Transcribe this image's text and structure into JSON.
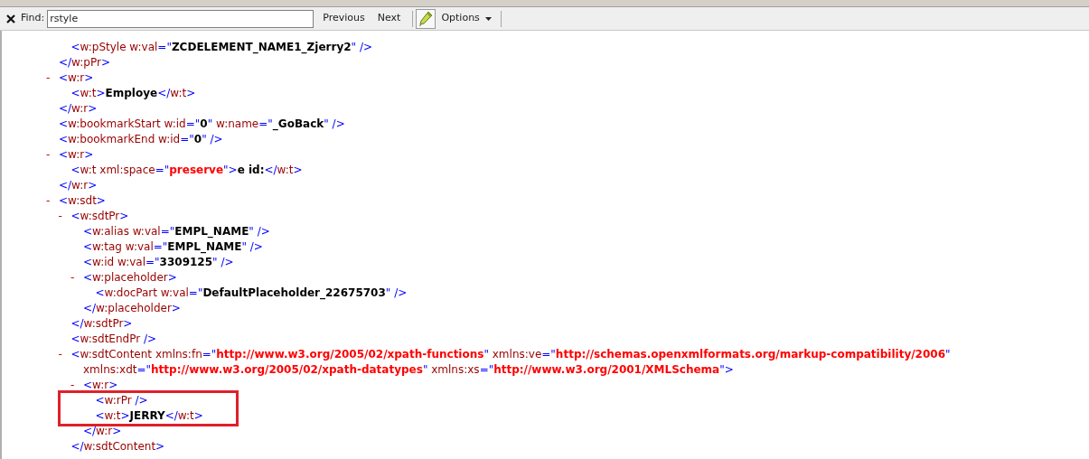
{
  "find_bar": {
    "label": "Find:",
    "value": "rstyle",
    "buttons": [
      "Previous",
      "Next"
    ],
    "marker_tool": {
      "pressed": true
    },
    "options": "Options"
  },
  "xml_tree": [
    {
      "children": [
        {
          "lines": [
            [
              {
                "kind": "punct",
                "text": "<"
              },
              {
                "kind": "name",
                "text": "w:pStyle w:val"
              },
              {
                "kind": "punct",
                "text": "=\""
              },
              {
                "kind": "value",
                "text": "ZCDELEMENT_NAME1_Zjerry2"
              },
              {
                "kind": "punct",
                "text": "\" />"
              }
            ]
          ]
        }
      ],
      "close": [
        {
          "kind": "punct",
          "text": "</"
        },
        {
          "kind": "name",
          "text": "w:pPr"
        },
        {
          "kind": "punct",
          "text": ">"
        }
      ]
    },
    {
      "toggle": "-",
      "lines": [
        [
          {
            "kind": "punct",
            "text": "<"
          },
          {
            "kind": "name",
            "text": "w:r"
          },
          {
            "kind": "punct",
            "text": ">"
          }
        ]
      ],
      "children": [
        {
          "lines": [
            [
              {
                "kind": "punct",
                "text": "<"
              },
              {
                "kind": "name",
                "text": "w:t"
              },
              {
                "kind": "punct",
                "text": ">"
              },
              {
                "kind": "value",
                "text": "Employe"
              },
              {
                "kind": "punct",
                "text": "</"
              },
              {
                "kind": "name",
                "text": "w:t"
              },
              {
                "kind": "punct",
                "text": ">"
              }
            ]
          ]
        }
      ],
      "close": [
        {
          "kind": "punct",
          "text": "</"
        },
        {
          "kind": "name",
          "text": "w:r"
        },
        {
          "kind": "punct",
          "text": ">"
        }
      ]
    },
    {
      "lines": [
        [
          {
            "kind": "punct",
            "text": "<"
          },
          {
            "kind": "name",
            "text": "w:bookmarkStart w:id"
          },
          {
            "kind": "punct",
            "text": "=\""
          },
          {
            "kind": "value",
            "text": "0"
          },
          {
            "kind": "punct",
            "text": "\""
          },
          {
            "kind": "name",
            "text": " w:name"
          },
          {
            "kind": "punct",
            "text": "=\""
          },
          {
            "kind": "value",
            "text": "_GoBack"
          },
          {
            "kind": "punct",
            "text": "\" />"
          }
        ]
      ]
    },
    {
      "lines": [
        [
          {
            "kind": "punct",
            "text": "<"
          },
          {
            "kind": "name",
            "text": "w:bookmarkEnd w:id"
          },
          {
            "kind": "punct",
            "text": "=\""
          },
          {
            "kind": "value",
            "text": "0"
          },
          {
            "kind": "punct",
            "text": "\" />"
          }
        ]
      ]
    },
    {
      "toggle": "-",
      "lines": [
        [
          {
            "kind": "punct",
            "text": "<"
          },
          {
            "kind": "name",
            "text": "w:r"
          },
          {
            "kind": "punct",
            "text": ">"
          }
        ]
      ],
      "children": [
        {
          "lines": [
            [
              {
                "kind": "punct",
                "text": "<"
              },
              {
                "kind": "name",
                "text": "w:t xml:space"
              },
              {
                "kind": "punct",
                "text": "=\""
              },
              {
                "kind": "red_value",
                "text": "preserve"
              },
              {
                "kind": "punct",
                "text": "\">"
              },
              {
                "kind": "value",
                "text": "e id:"
              },
              {
                "kind": "punct",
                "text": "</"
              },
              {
                "kind": "name",
                "text": "w:t"
              },
              {
                "kind": "punct",
                "text": ">"
              }
            ]
          ]
        }
      ],
      "close": [
        {
          "kind": "punct",
          "text": "</"
        },
        {
          "kind": "name",
          "text": "w:r"
        },
        {
          "kind": "punct",
          "text": ">"
        }
      ]
    },
    {
      "toggle": "-",
      "lines": [
        [
          {
            "kind": "punct",
            "text": "<"
          },
          {
            "kind": "name",
            "text": "w:sdt"
          },
          {
            "kind": "punct",
            "text": ">"
          }
        ]
      ],
      "children": [
        {
          "toggle": "-",
          "lines": [
            [
              {
                "kind": "punct",
                "text": "<"
              },
              {
                "kind": "name",
                "text": "w:sdtPr"
              },
              {
                "kind": "punct",
                "text": ">"
              }
            ]
          ],
          "children": [
            {
              "lines": [
                [
                  {
                    "kind": "punct",
                    "text": "<"
                  },
                  {
                    "kind": "name",
                    "text": "w:alias w:val"
                  },
                  {
                    "kind": "punct",
                    "text": "=\""
                  },
                  {
                    "kind": "value",
                    "text": "EMPL_NAME"
                  },
                  {
                    "kind": "punct",
                    "text": "\" />"
                  }
                ]
              ]
            },
            {
              "lines": [
                [
                  {
                    "kind": "punct",
                    "text": "<"
                  },
                  {
                    "kind": "name",
                    "text": "w:tag w:val"
                  },
                  {
                    "kind": "punct",
                    "text": "=\""
                  },
                  {
                    "kind": "value",
                    "text": "EMPL_NAME"
                  },
                  {
                    "kind": "punct",
                    "text": "\" />"
                  }
                ]
              ]
            },
            {
              "lines": [
                [
                  {
                    "kind": "punct",
                    "text": "<"
                  },
                  {
                    "kind": "name",
                    "text": "w:id w:val"
                  },
                  {
                    "kind": "punct",
                    "text": "=\""
                  },
                  {
                    "kind": "value",
                    "text": "3309125"
                  },
                  {
                    "kind": "punct",
                    "text": "\" />"
                  }
                ]
              ]
            },
            {
              "toggle": "-",
              "lines": [
                [
                  {
                    "kind": "punct",
                    "text": "<"
                  },
                  {
                    "kind": "name",
                    "text": "w:placeholder"
                  },
                  {
                    "kind": "punct",
                    "text": ">"
                  }
                ]
              ],
              "children": [
                {
                  "lines": [
                    [
                      {
                        "kind": "punct",
                        "text": "<"
                      },
                      {
                        "kind": "name",
                        "text": "w:docPart w:val"
                      },
                      {
                        "kind": "punct",
                        "text": "=\""
                      },
                      {
                        "kind": "value",
                        "text": "DefaultPlaceholder_22675703"
                      },
                      {
                        "kind": "punct",
                        "text": "\" />"
                      }
                    ]
                  ]
                }
              ],
              "close": [
                {
                  "kind": "punct",
                  "text": "</"
                },
                {
                  "kind": "name",
                  "text": "w:placeholder"
                },
                {
                  "kind": "punct",
                  "text": ">"
                }
              ]
            }
          ],
          "close": [
            {
              "kind": "punct",
              "text": "</"
            },
            {
              "kind": "name",
              "text": "w:sdtPr"
            },
            {
              "kind": "punct",
              "text": ">"
            }
          ]
        },
        {
          "lines": [
            [
              {
                "kind": "punct",
                "text": "<"
              },
              {
                "kind": "name",
                "text": "w:sdtEndPr"
              },
              {
                "kind": "punct",
                "text": " />"
              }
            ]
          ]
        },
        {
          "toggle": "-",
          "lines": [
            [
              {
                "kind": "punct",
                "text": "<"
              },
              {
                "kind": "name",
                "text": "w:sdtContent xmlns:fn"
              },
              {
                "kind": "punct",
                "text": "=\""
              },
              {
                "kind": "red_value",
                "text": "http://www.w3.org/2005/02/xpath-functions"
              },
              {
                "kind": "punct",
                "text": "\""
              },
              {
                "kind": "name",
                "text": " xmlns:ve"
              },
              {
                "kind": "punct",
                "text": "=\""
              },
              {
                "kind": "red_value",
                "text": "http://schemas.openxmlformats.org/markup-compatibility/2006"
              },
              {
                "kind": "punct",
                "text": "\""
              }
            ],
            [
              {
                "kind": "name",
                "text": "xmlns:xdt"
              },
              {
                "kind": "punct",
                "text": "=\""
              },
              {
                "kind": "red_value",
                "text": "http://www.w3.org/2005/02/xpath-datatypes"
              },
              {
                "kind": "punct",
                "text": "\""
              },
              {
                "kind": "name",
                "text": " xmlns:xs"
              },
              {
                "kind": "punct",
                "text": "=\""
              },
              {
                "kind": "red_value",
                "text": "http://www.w3.org/2001/XMLSchema"
              },
              {
                "kind": "punct",
                "text": "\">"
              }
            ]
          ],
          "children": [
            {
              "toggle": "-",
              "lines": [
                [
                  {
                    "kind": "punct",
                    "text": "<"
                  },
                  {
                    "kind": "name",
                    "text": "w:r"
                  },
                  {
                    "kind": "punct",
                    "text": ">"
                  }
                ]
              ],
              "children": [
                {
                  "kind": "highlight_box",
                  "children": [
                    {
                      "lines": [
                        [
                          {
                            "kind": "punct",
                            "text": "<"
                          },
                          {
                            "kind": "name",
                            "text": "w:rPr"
                          },
                          {
                            "kind": "punct",
                            "text": " />"
                          }
                        ]
                      ]
                    },
                    {
                      "lines": [
                        [
                          {
                            "kind": "punct",
                            "text": "<"
                          },
                          {
                            "kind": "name",
                            "text": "w:t"
                          },
                          {
                            "kind": "punct",
                            "text": ">"
                          },
                          {
                            "kind": "value",
                            "text": "JERRY"
                          },
                          {
                            "kind": "punct",
                            "text": "</"
                          },
                          {
                            "kind": "name",
                            "text": "w:t"
                          },
                          {
                            "kind": "punct",
                            "text": ">"
                          }
                        ]
                      ]
                    }
                  ]
                }
              ],
              "close": [
                {
                  "kind": "punct",
                  "text": "</"
                },
                {
                  "kind": "name",
                  "text": "w:r"
                },
                {
                  "kind": "punct",
                  "text": ">"
                }
              ]
            }
          ],
          "close": [
            {
              "kind": "punct",
              "text": "</"
            },
            {
              "kind": "name",
              "text": "w:sdtContent"
            },
            {
              "kind": "punct",
              "text": ">"
            }
          ]
        }
      ]
    }
  ]
}
